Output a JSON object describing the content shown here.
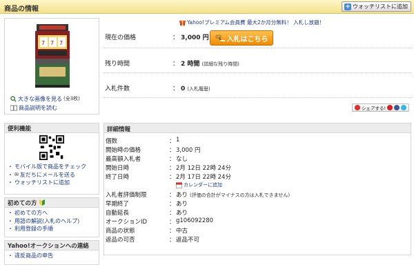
{
  "header": {
    "title": "商品の情報",
    "watchlist_button": "ウォッチリストに追加"
  },
  "promo": {
    "text": "Yahoo!プレミアム会員費 最大2か月分無料！ 入札し放題！"
  },
  "image_links": {
    "large_image": "大きな画像を見る",
    "large_image_count": "(全3枚)",
    "description": "商品説明を読む"
  },
  "price": {
    "label": "現在の価格",
    "colon": "：",
    "value": "3,000 円"
  },
  "bid_button": "入札はこちら",
  "remaining": {
    "label": "残り時間",
    "colon": "：",
    "value": "2 時間",
    "detail": "(詳細な残り時間)"
  },
  "bids": {
    "label": "入札件数",
    "colon": "：",
    "value": "0",
    "history": "(入札履歴)"
  },
  "share": {
    "label": "シェアする!"
  },
  "convenience": {
    "title": "便利機能",
    "items": [
      "モバイル版で商品をチェック",
      "友だちにメールを送る",
      "ウォッチリストに追加"
    ]
  },
  "beginners": {
    "title": "初めての方",
    "items": [
      "初めての方へ",
      "用語の解説(入札のヘルプ)",
      "利用登録の手順"
    ]
  },
  "contact": {
    "title": "Yahoo!オークションへの連絡",
    "items": [
      "違反商品の申告"
    ]
  },
  "details": {
    "title": "詳細情報",
    "rows": [
      {
        "label": "個数",
        "colon": "：",
        "value": "1"
      },
      {
        "label": "開始時の価格",
        "colon": "：",
        "value": "3,000 円"
      },
      {
        "label": "最高額入札者",
        "colon": "：",
        "value": "なし"
      },
      {
        "label": "開始日時",
        "colon": "：",
        "value": "2月 12日 22時 24分"
      },
      {
        "label": "終了日時",
        "colon": "：",
        "value": "2月 17日 22時 24分"
      },
      {
        "label": "入札者評価制限",
        "colon": "：",
        "value": "あり",
        "note": "(評価の合計がマイナスの方は入札できません)"
      },
      {
        "label": "早期終了",
        "colon": "：",
        "value": "あり"
      },
      {
        "label": "自動延長",
        "colon": "：",
        "value": "あり"
      },
      {
        "label": "オークションID",
        "colon": "：",
        "value": "g106092280"
      },
      {
        "label": "商品の状態",
        "colon": "：",
        "value": "中古"
      },
      {
        "label": "返品の可否",
        "colon": "：",
        "value": "返品不可"
      }
    ],
    "calendar_link": "カレンダーに追加"
  },
  "colors": {
    "header_bg": "#f3e28a",
    "bid_button": "#f08a00",
    "link": "#1a3a8a"
  }
}
